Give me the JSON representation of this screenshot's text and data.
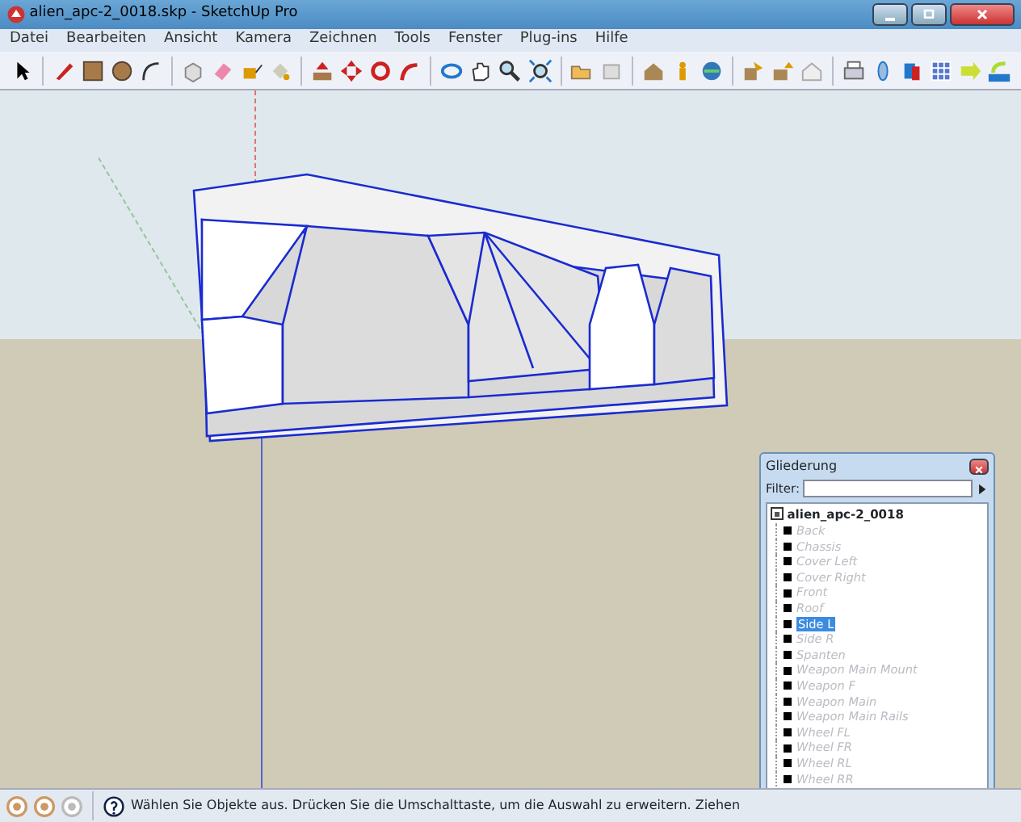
{
  "window": {
    "title": "alien_apc-2_0018.skp - SketchUp Pro"
  },
  "menu": [
    "Datei",
    "Bearbeiten",
    "Ansicht",
    "Kamera",
    "Zeichnen",
    "Tools",
    "Fenster",
    "Plug-ins",
    "Hilfe"
  ],
  "outliner": {
    "title": "Gliederung",
    "filter_label": "Filter:",
    "root": {
      "label": "alien_apc-2_0018",
      "children": [
        {
          "label": "Back",
          "hidden": true,
          "selected": false
        },
        {
          "label": "Chassis",
          "hidden": true,
          "selected": false
        },
        {
          "label": "Cover Left",
          "hidden": true,
          "selected": false
        },
        {
          "label": "Cover Right",
          "hidden": true,
          "selected": false
        },
        {
          "label": "Front",
          "hidden": true,
          "selected": false
        },
        {
          "label": "Roof",
          "hidden": true,
          "selected": false
        },
        {
          "label": "Side L",
          "hidden": false,
          "selected": true
        },
        {
          "label": "Side R",
          "hidden": true,
          "selected": false
        },
        {
          "label": "Spanten",
          "hidden": true,
          "selected": false
        },
        {
          "label": "Weapon Main Mount",
          "hidden": true,
          "selected": false
        },
        {
          "label": "Weapon F",
          "hidden": true,
          "selected": false
        },
        {
          "label": "Weapon Main",
          "hidden": true,
          "selected": false
        },
        {
          "label": "Weapon Main Rails",
          "hidden": true,
          "selected": false
        },
        {
          "label": "Wheel FL",
          "hidden": true,
          "selected": false
        },
        {
          "label": "Wheel FR",
          "hidden": true,
          "selected": false
        },
        {
          "label": "Wheel RL",
          "hidden": true,
          "selected": false
        },
        {
          "label": "Wheel RR",
          "hidden": true,
          "selected": false
        }
      ]
    }
  },
  "status_bar": {
    "message": "Wählen Sie Objekte aus. Drücken Sie die Umschalttaste, um die Auswahl zu erweitern. Ziehen"
  }
}
